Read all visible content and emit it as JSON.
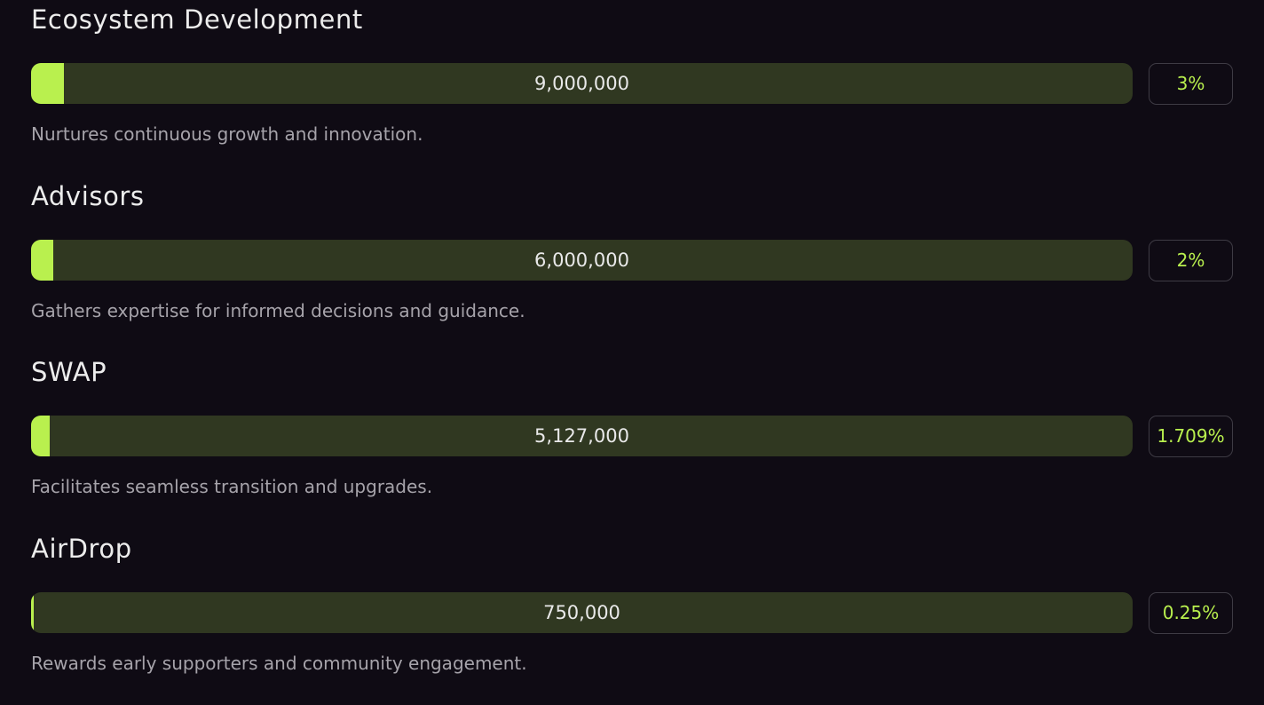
{
  "allocations": [
    {
      "title": "Ecosystem Development",
      "amount": "9,000,000",
      "percent_label": "3%",
      "percent_value": 3,
      "description": "Nurtures continuous growth and innovation."
    },
    {
      "title": "Advisors",
      "amount": "6,000,000",
      "percent_label": "2%",
      "percent_value": 2,
      "description": "Gathers expertise for informed decisions and guidance."
    },
    {
      "title": "SWAP",
      "amount": "5,127,000",
      "percent_label": "1.709%",
      "percent_value": 1.709,
      "description": "Facilitates seamless transition and upgrades."
    },
    {
      "title": "AirDrop",
      "amount": "750,000",
      "percent_label": "0.25%",
      "percent_value": 0.25,
      "description": "Rewards early supporters and community engagement."
    }
  ],
  "colors": {
    "background": "#0f0b14",
    "bar_track": "#303821",
    "accent": "#b9f04e",
    "description": "#a6a3aa"
  }
}
